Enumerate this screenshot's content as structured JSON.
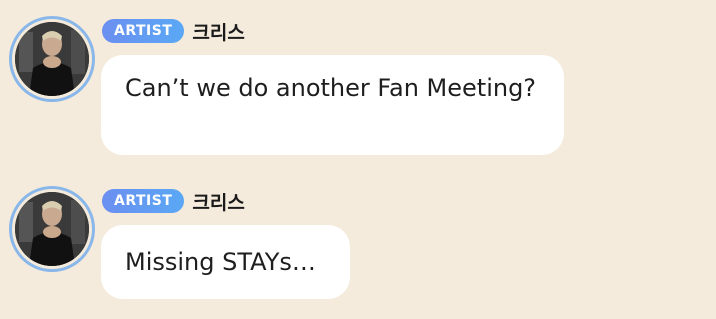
{
  "messages": [
    {
      "badge": "ARTIST",
      "author": "크리스",
      "text": "Can’t we do another Fan Meeting?"
    },
    {
      "badge": "ARTIST",
      "author": "크리스",
      "text": "Missing STAYs…"
    }
  ],
  "colors": {
    "background": "#f4ebdc",
    "badge_start": "#6b8ff0",
    "badge_end": "#5aa8f5",
    "avatar_ring": "#8ab7ea",
    "bubble": "#ffffff"
  }
}
